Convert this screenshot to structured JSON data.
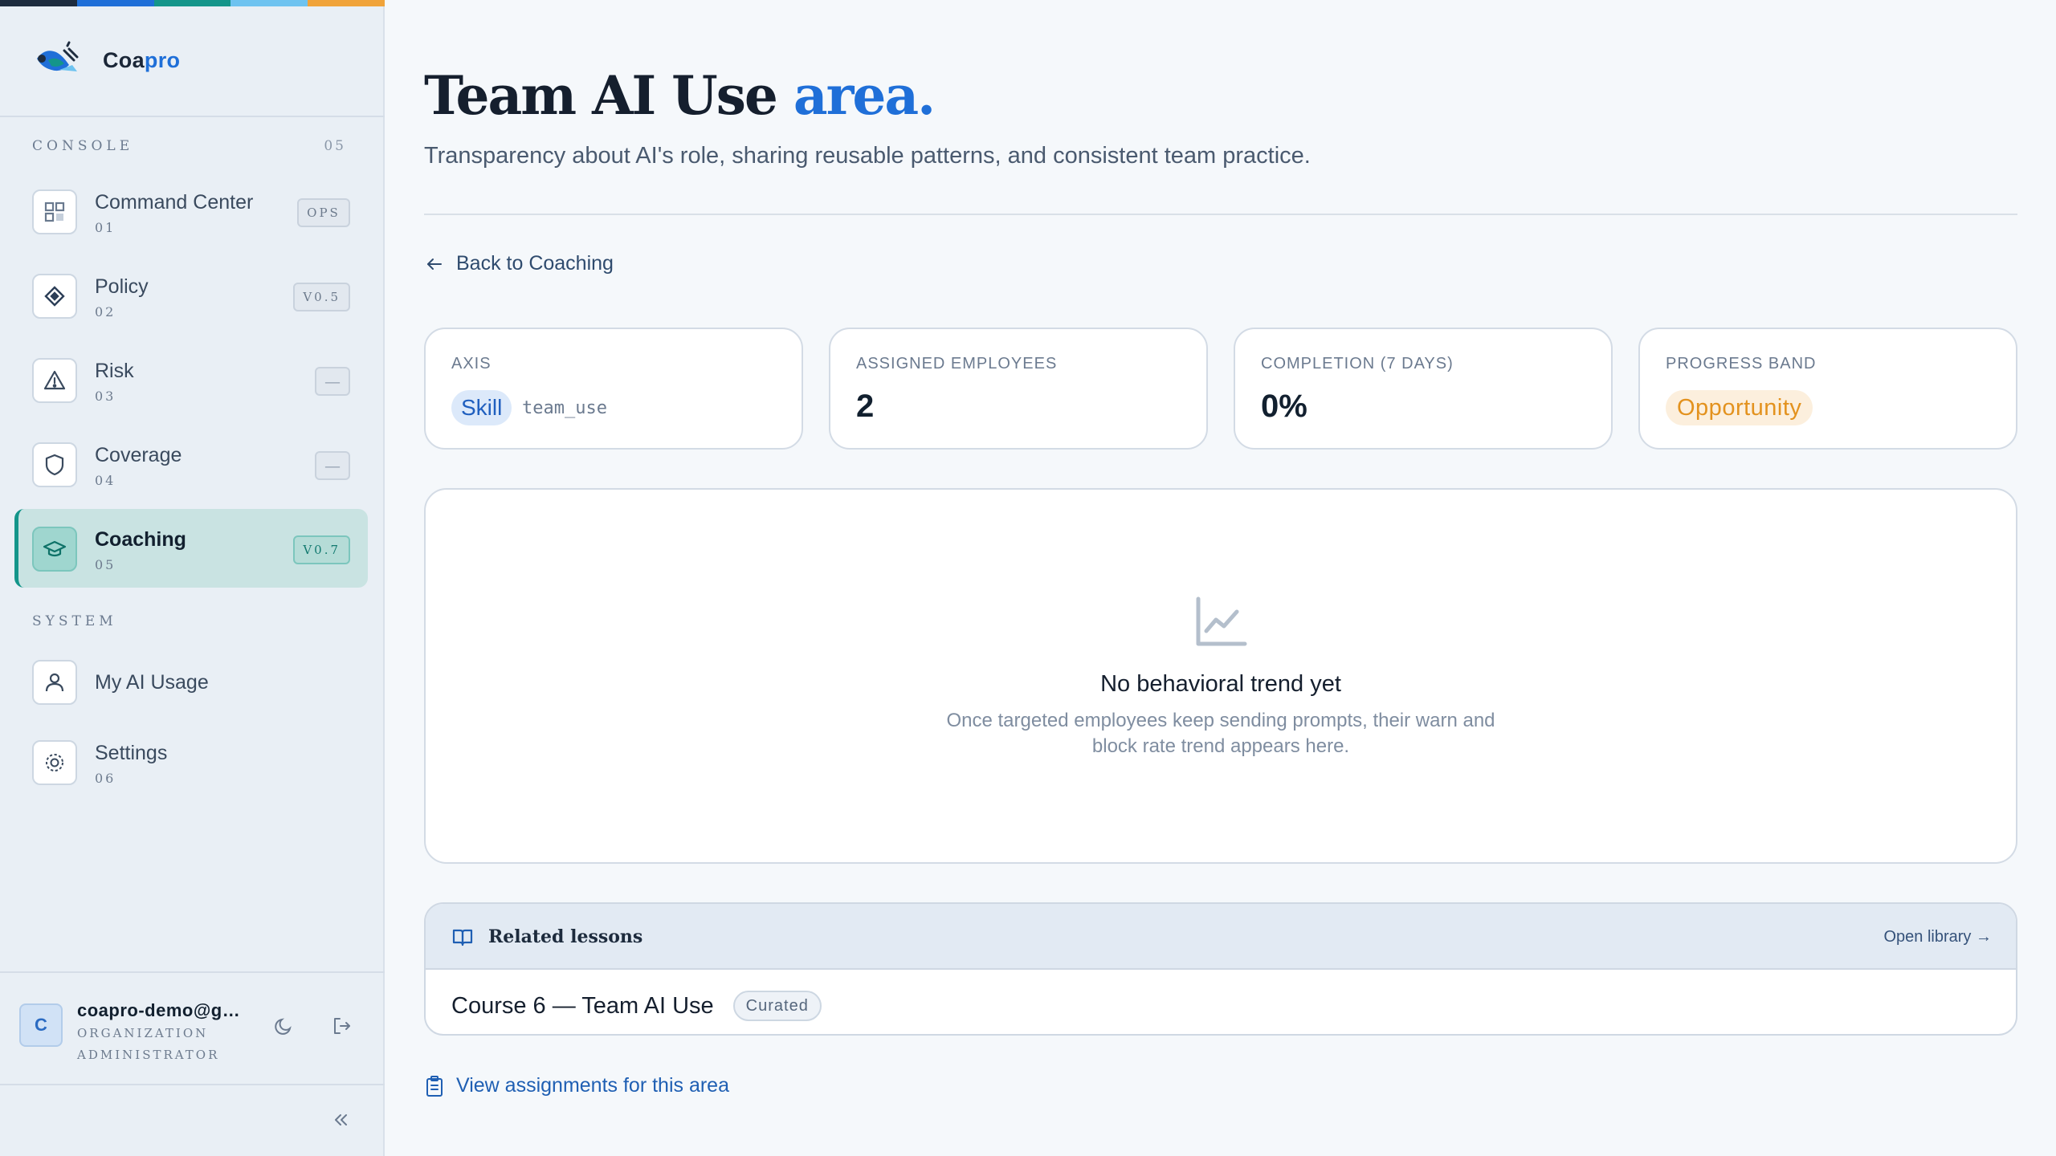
{
  "colors": {
    "strip": [
      "#1e2c3f",
      "#1f6fd8",
      "#14958a",
      "#6ec3f0",
      "#f0a33a"
    ],
    "accent": "#1f6fd8",
    "active_nav": "#14958a",
    "band_opportunity": "#e3921e"
  },
  "brand": {
    "name_part1": "Coa",
    "name_part2": "pro",
    "logo_icon": "coapro-logo-icon"
  },
  "sidebar": {
    "console_label": "CONSOLE",
    "console_count": "05",
    "items": [
      {
        "label": "Command Center",
        "num": "01",
        "badge": "OPS",
        "icon": "grid-icon",
        "active": false
      },
      {
        "label": "Policy",
        "num": "02",
        "badge": "V0.5",
        "icon": "diamond-icon",
        "active": false
      },
      {
        "label": "Risk",
        "num": "03",
        "badge": "—",
        "icon": "warning-icon",
        "active": false
      },
      {
        "label": "Coverage",
        "num": "04",
        "badge": "—",
        "icon": "shield-icon",
        "active": false
      },
      {
        "label": "Coaching",
        "num": "05",
        "badge": "V0.7",
        "icon": "graduation-cap-icon",
        "active": true
      }
    ],
    "system_label": "SYSTEM",
    "system_items": [
      {
        "label": "My AI Usage",
        "num": "",
        "icon": "user-icon"
      },
      {
        "label": "Settings",
        "num": "06",
        "icon": "gear-icon"
      }
    ],
    "user": {
      "avatar_letter": "C",
      "email": "coapro-demo@g…",
      "role": "ORGANIZATION ADMINISTRATOR"
    }
  },
  "page": {
    "title_main": "Team AI Use ",
    "title_accent": "area.",
    "subtitle": "Transparency about AI's role, sharing reusable patterns, and consistent team practice.",
    "back_link": "Back to Coaching"
  },
  "stats": {
    "axis": {
      "label": "AXIS",
      "skill": "Skill",
      "tag": "team_use"
    },
    "assigned": {
      "label": "ASSIGNED EMPLOYEES",
      "value": "2"
    },
    "completion": {
      "label": "COMPLETION (7 DAYS)",
      "value": "0%"
    },
    "band": {
      "label": "PROGRESS BAND",
      "value": "Opportunity"
    }
  },
  "trend": {
    "title": "No behavioral trend yet",
    "description": "Once targeted employees keep sending prompts, their warn and block rate trend appears here."
  },
  "lessons": {
    "title": "Related lessons",
    "open_library": "Open library →",
    "items": [
      {
        "name": "Course 6 — Team AI Use",
        "tag": "Curated"
      }
    ]
  },
  "assignments_link": "View assignments for this area"
}
